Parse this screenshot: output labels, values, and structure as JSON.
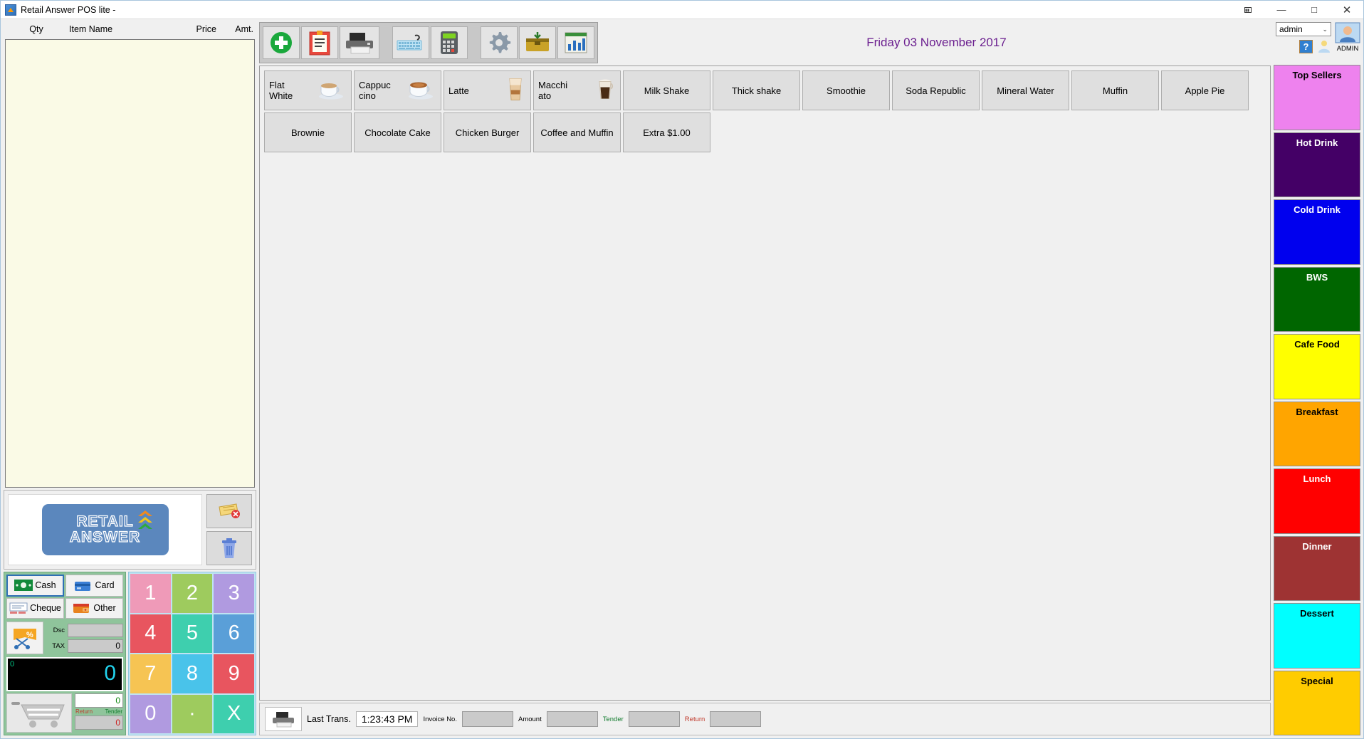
{
  "window": {
    "title": "Retail Answer POS lite -",
    "controls": {
      "restore_down": "restore-icon",
      "minimize": "—",
      "maximize": "□",
      "close": "✕"
    }
  },
  "cart": {
    "headers": {
      "qty": "Qty",
      "item_name": "Item Name",
      "price": "Price",
      "amount": "Amt."
    },
    "rows": []
  },
  "logo": {
    "line1": "RETAIL",
    "line2": "ANSWER"
  },
  "side_buttons": [
    {
      "name": "void-ticket-button",
      "icon": "ticket-void-icon"
    },
    {
      "name": "delete-button",
      "icon": "trash-icon"
    }
  ],
  "payment": {
    "methods": [
      {
        "label": "Cash",
        "icon": "cash-icon",
        "selected": true
      },
      {
        "label": "Card",
        "icon": "card-icon",
        "selected": false
      },
      {
        "label": "Cheque",
        "icon": "cheque-icon",
        "selected": false
      },
      {
        "label": "Other",
        "icon": "wallet-icon",
        "selected": false
      }
    ],
    "discount_icon": "discount-scissors-icon",
    "disc_label": "Dsc",
    "disc_value": "",
    "tax_label": "TAX",
    "tax_value": "0",
    "display_small": "0",
    "display_big": "0",
    "cart_icon": "shopping-cart-icon",
    "tender_label": "Tender",
    "tender_value": "0",
    "return_label": "Return",
    "return_value": "0"
  },
  "keypad": [
    {
      "label": "1",
      "color": "#ef9ab8"
    },
    {
      "label": "2",
      "color": "#9ecb5e"
    },
    {
      "label": "3",
      "color": "#b09ae0"
    },
    {
      "label": "4",
      "color": "#e8555f"
    },
    {
      "label": "5",
      "color": "#3ecfae"
    },
    {
      "label": "6",
      "color": "#5a9fd8"
    },
    {
      "label": "7",
      "color": "#f6c453"
    },
    {
      "label": "8",
      "color": "#49c3ea"
    },
    {
      "label": "9",
      "color": "#e8555f"
    },
    {
      "label": "0",
      "color": "#b09ae0"
    },
    {
      "label": "·",
      "color": "#9ecb5e"
    },
    {
      "label": "X",
      "color": "#3ecfae"
    }
  ],
  "toolbar": [
    {
      "name": "new-sale-button",
      "icon": "green-plus-icon"
    },
    {
      "name": "orders-button",
      "icon": "clipboard-icon"
    },
    {
      "name": "print-button",
      "icon": "printer-icon"
    },
    {
      "name": "keyboard-button",
      "icon": "keyboard-icon"
    },
    {
      "name": "calculator-button",
      "icon": "calculator-icon"
    },
    {
      "name": "settings-button",
      "icon": "gear-icon"
    },
    {
      "name": "cash-drawer-button",
      "icon": "drawer-icon"
    },
    {
      "name": "reports-button",
      "icon": "report-icon"
    }
  ],
  "header": {
    "date": "Friday   03 November 2017"
  },
  "products": [
    [
      {
        "label": "Flat\nWhite",
        "image": "flat-white-cup-icon"
      },
      {
        "label": "Cappuc\ncino",
        "image": "cappuccino-cup-icon"
      },
      {
        "label": "Latte",
        "image": "latte-glass-icon"
      },
      {
        "label": "Macchi\nato",
        "image": "macchiato-glass-icon"
      },
      {
        "label": "Milk Shake",
        "image": null
      },
      {
        "label": "Thick shake",
        "image": null
      },
      {
        "label": "Smoothie",
        "image": null
      },
      {
        "label": "Soda Republic",
        "image": null
      },
      {
        "label": "Mineral Water",
        "image": null
      },
      {
        "label": "Muffin",
        "image": null
      },
      {
        "label": "Apple Pie",
        "image": null
      }
    ],
    [
      {
        "label": "Brownie",
        "image": null
      },
      {
        "label": "Chocolate Cake",
        "image": null
      },
      {
        "label": "Chicken Burger",
        "image": null
      },
      {
        "label": "Coffee and Muffin",
        "image": null
      },
      {
        "label": "Extra $1.00",
        "image": null
      }
    ]
  ],
  "statusbar": {
    "printer_icon": "printer-icon",
    "last_trans_label": "Last Trans.",
    "last_trans_time": "1:23:43 PM",
    "invoice_label": "Invoice No.",
    "invoice_value": "",
    "amount_label": "Amount",
    "amount_value": "",
    "tender_label": "Tender",
    "tender_value": "",
    "return_label": "Return",
    "return_value": ""
  },
  "user": {
    "select_value": "admin",
    "chevron": "⌄",
    "help_label": "?",
    "avatar_label": "ADMIN"
  },
  "categories": [
    {
      "label": "Top Sellers",
      "bg": "#ee82ee",
      "fg": "#000000"
    },
    {
      "label": "Hot Drink",
      "bg": "#440066",
      "fg": "#ffffff"
    },
    {
      "label": "Cold Drink",
      "bg": "#0000ee",
      "fg": "#ffffff"
    },
    {
      "label": "BWS",
      "bg": "#006600",
      "fg": "#ffffff"
    },
    {
      "label": "Cafe Food",
      "bg": "#ffff00",
      "fg": "#000000"
    },
    {
      "label": "Breakfast",
      "bg": "#ffa500",
      "fg": "#000000"
    },
    {
      "label": "Lunch",
      "bg": "#ff0000",
      "fg": "#ffffff"
    },
    {
      "label": "Dinner",
      "bg": "#9e3333",
      "fg": "#ffffff"
    },
    {
      "label": "Dessert",
      "bg": "#00ffff",
      "fg": "#000000"
    },
    {
      "label": "Special",
      "bg": "#ffcc00",
      "fg": "#000000"
    }
  ]
}
